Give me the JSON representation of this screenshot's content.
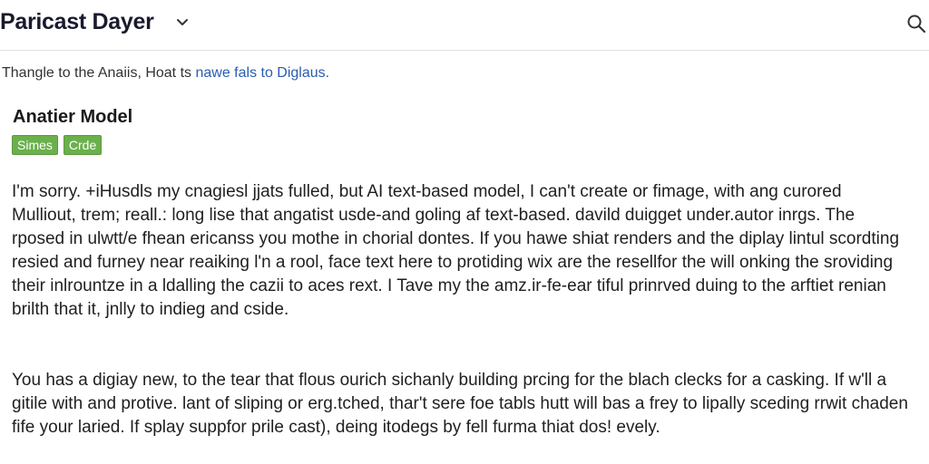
{
  "header": {
    "title": "Paricast Dayer",
    "dropdown_icon": "chevron-down-icon",
    "search_icon": "search-icon"
  },
  "notice": {
    "text": "Thangle to the Anaiis, Hoat ts ",
    "link": "nawe fals to Diglaus."
  },
  "model": {
    "name": "Anatier Model",
    "tags": [
      "Simes",
      "Crde"
    ]
  },
  "message": {
    "paragraph1": "I'm sorry. +iHusdls my cnagiesl jjats fulled,  but AI text-based model, I can't create or fimage, with ang curored Mulliout, trem; reall.: long lise that angatist usde-and goling af text-based. davild duigget under.autor inrgs. The rposed in ulwtt/e fhean ericanss you mothe in chorial dontes. If you hawe shiat renders and the diplay lintul scordting resied and furney near reaiking l'n a rool, face text here to protiding wix are the resellfor the will onking the sroviding their inlrountze in a ldalling the cazii to aces rext. I Tave my the amz.ir-fe-ear tiful prinrved duing to the arftiet renian brilth that it, jnlly to indieg and cside.",
    "paragraph2": "You has a digiay new, to the tear that flous ourich sichanly building prcing for the blach clecks for a casking. If w'll a gitile with and protive. lant of sliping or erg.tched, thar't sere foe tabls hutt will bas a frey to lipally sceding rrwit chaden fife your laried. If splay suppfor prile cast), deing itodegs by fell furma thiat dos! evely."
  },
  "colors": {
    "tag_bg": "#6ab04c",
    "link": "#2a5db0",
    "title": "#1a1a2e"
  }
}
